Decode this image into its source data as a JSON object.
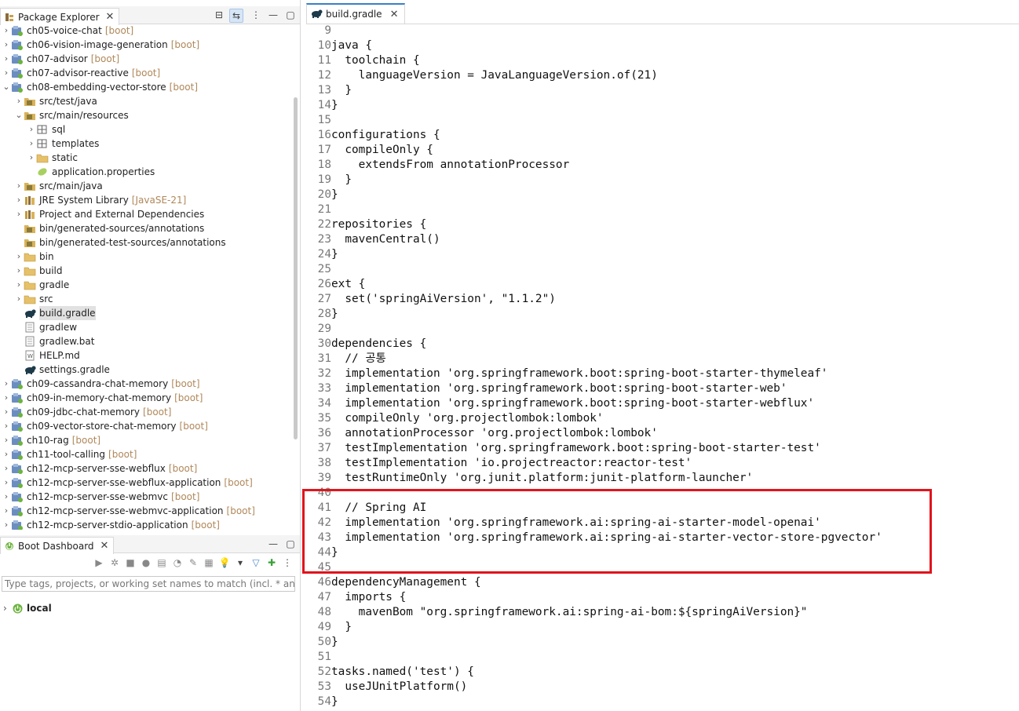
{
  "package_explorer": {
    "title": "Package Explorer",
    "tree": [
      {
        "label": "ch05-voice-chat",
        "decoration": "[boot]",
        "level": 0,
        "twisty": ">",
        "icon": "project-icon"
      },
      {
        "label": "ch06-vision-image-generation",
        "decoration": "[boot]",
        "level": 0,
        "twisty": ">",
        "icon": "project-icon"
      },
      {
        "label": "ch07-advisor",
        "decoration": "[boot]",
        "level": 0,
        "twisty": ">",
        "icon": "project-icon"
      },
      {
        "label": "ch07-advisor-reactive",
        "decoration": "[boot]",
        "level": 0,
        "twisty": ">",
        "icon": "project-icon"
      },
      {
        "label": "ch08-embedding-vector-store",
        "decoration": "[boot]",
        "level": 0,
        "twisty": "v",
        "icon": "project-icon"
      },
      {
        "label": "src/test/java",
        "decoration": "",
        "level": 1,
        "twisty": ">",
        "icon": "source-folder-icon"
      },
      {
        "label": "src/main/resources",
        "decoration": "",
        "level": 1,
        "twisty": "v",
        "icon": "source-folder-icon"
      },
      {
        "label": "sql",
        "decoration": "",
        "level": 2,
        "twisty": ">",
        "icon": "package-icon"
      },
      {
        "label": "templates",
        "decoration": "",
        "level": 2,
        "twisty": ">",
        "icon": "package-icon"
      },
      {
        "label": "static",
        "decoration": "",
        "level": 2,
        "twisty": ">",
        "icon": "folder-icon"
      },
      {
        "label": "application.properties",
        "decoration": "",
        "level": 2,
        "twisty": "",
        "icon": "properties-file-icon"
      },
      {
        "label": "src/main/java",
        "decoration": "",
        "level": 1,
        "twisty": ">",
        "icon": "source-folder-icon"
      },
      {
        "label": "JRE System Library",
        "decoration": "[JavaSE-21]",
        "level": 1,
        "twisty": ">",
        "icon": "library-icon"
      },
      {
        "label": "Project and External Dependencies",
        "decoration": "",
        "level": 1,
        "twisty": ">",
        "icon": "library-icon"
      },
      {
        "label": "bin/generated-sources/annotations",
        "decoration": "",
        "level": 1,
        "twisty": "",
        "icon": "source-folder-icon"
      },
      {
        "label": "bin/generated-test-sources/annotations",
        "decoration": "",
        "level": 1,
        "twisty": "",
        "icon": "source-folder-icon"
      },
      {
        "label": "bin",
        "decoration": "",
        "level": 1,
        "twisty": ">",
        "icon": "folder-icon"
      },
      {
        "label": "build",
        "decoration": "",
        "level": 1,
        "twisty": ">",
        "icon": "folder-icon"
      },
      {
        "label": "gradle",
        "decoration": "",
        "level": 1,
        "twisty": ">",
        "icon": "folder-icon"
      },
      {
        "label": "src",
        "decoration": "",
        "level": 1,
        "twisty": ">",
        "icon": "folder-icon"
      },
      {
        "label": "build.gradle",
        "decoration": "",
        "level": 1,
        "twisty": "",
        "icon": "gradle-elephant-icon",
        "selected": true
      },
      {
        "label": "gradlew",
        "decoration": "",
        "level": 1,
        "twisty": "",
        "icon": "text-file-icon"
      },
      {
        "label": "gradlew.bat",
        "decoration": "",
        "level": 1,
        "twisty": "",
        "icon": "text-file-icon"
      },
      {
        "label": "HELP.md",
        "decoration": "",
        "level": 1,
        "twisty": "",
        "icon": "markdown-file-icon"
      },
      {
        "label": "settings.gradle",
        "decoration": "",
        "level": 1,
        "twisty": "",
        "icon": "gradle-elephant-icon"
      },
      {
        "label": "ch09-cassandra-chat-memory",
        "decoration": "[boot]",
        "level": 0,
        "twisty": ">",
        "icon": "project-icon"
      },
      {
        "label": "ch09-in-memory-chat-memory",
        "decoration": "[boot]",
        "level": 0,
        "twisty": ">",
        "icon": "project-icon"
      },
      {
        "label": "ch09-jdbc-chat-memory",
        "decoration": "[boot]",
        "level": 0,
        "twisty": ">",
        "icon": "project-icon"
      },
      {
        "label": "ch09-vector-store-chat-memory",
        "decoration": "[boot]",
        "level": 0,
        "twisty": ">",
        "icon": "project-icon"
      },
      {
        "label": "ch10-rag",
        "decoration": "[boot]",
        "level": 0,
        "twisty": ">",
        "icon": "project-icon"
      },
      {
        "label": "ch11-tool-calling",
        "decoration": "[boot]",
        "level": 0,
        "twisty": ">",
        "icon": "project-icon"
      },
      {
        "label": "ch12-mcp-server-sse-webflux",
        "decoration": "[boot]",
        "level": 0,
        "twisty": ">",
        "icon": "project-icon"
      },
      {
        "label": "ch12-mcp-server-sse-webflux-application",
        "decoration": "[boot]",
        "level": 0,
        "twisty": ">",
        "icon": "project-icon"
      },
      {
        "label": "ch12-mcp-server-sse-webmvc",
        "decoration": "[boot]",
        "level": 0,
        "twisty": ">",
        "icon": "project-icon"
      },
      {
        "label": "ch12-mcp-server-sse-webmvc-application",
        "decoration": "[boot]",
        "level": 0,
        "twisty": ">",
        "icon": "project-icon"
      },
      {
        "label": "ch12-mcp-server-stdio-application",
        "decoration": "[boot]",
        "level": 0,
        "twisty": ">",
        "icon": "project-icon"
      }
    ]
  },
  "boot_dashboard": {
    "title": "Boot Dashboard",
    "filter_placeholder": "Type tags, projects, or working set names to match (incl. * and ? wilc",
    "local_label": "local"
  },
  "editor": {
    "tab_label": "build.gradle",
    "lines": [
      {
        "n": "9",
        "t": ""
      },
      {
        "n": "10",
        "t": "java {"
      },
      {
        "n": "11",
        "t": "  toolchain {"
      },
      {
        "n": "12",
        "t": "    languageVersion = JavaLanguageVersion.of(21)"
      },
      {
        "n": "13",
        "t": "  }"
      },
      {
        "n": "14",
        "t": "}"
      },
      {
        "n": "15",
        "t": ""
      },
      {
        "n": "16",
        "t": "configurations {"
      },
      {
        "n": "17",
        "t": "  compileOnly {"
      },
      {
        "n": "18",
        "t": "    extendsFrom annotationProcessor"
      },
      {
        "n": "19",
        "t": "  }"
      },
      {
        "n": "20",
        "t": "}"
      },
      {
        "n": "21",
        "t": ""
      },
      {
        "n": "22",
        "t": "repositories {"
      },
      {
        "n": "23",
        "t": "  mavenCentral()"
      },
      {
        "n": "24",
        "t": "}"
      },
      {
        "n": "25",
        "t": ""
      },
      {
        "n": "26",
        "t": "ext {"
      },
      {
        "n": "27",
        "t": "  set('springAiVersion', \"1.1.2\")"
      },
      {
        "n": "28",
        "t": "}"
      },
      {
        "n": "29",
        "t": ""
      },
      {
        "n": "30",
        "t": "dependencies {"
      },
      {
        "n": "31",
        "t": "  // 공통"
      },
      {
        "n": "32",
        "t": "  implementation 'org.springframework.boot:spring-boot-starter-thymeleaf'"
      },
      {
        "n": "33",
        "t": "  implementation 'org.springframework.boot:spring-boot-starter-web'"
      },
      {
        "n": "34",
        "t": "  implementation 'org.springframework.boot:spring-boot-starter-webflux'"
      },
      {
        "n": "35",
        "t": "  compileOnly 'org.projectlombok:lombok'"
      },
      {
        "n": "36",
        "t": "  annotationProcessor 'org.projectlombok:lombok'"
      },
      {
        "n": "37",
        "t": "  testImplementation 'org.springframework.boot:spring-boot-starter-test'"
      },
      {
        "n": "38",
        "t": "  testImplementation 'io.projectreactor:reactor-test'"
      },
      {
        "n": "39",
        "t": "  testRuntimeOnly 'org.junit.platform:junit-platform-launcher'"
      },
      {
        "n": "40",
        "t": ""
      },
      {
        "n": "41",
        "t": "  // Spring AI"
      },
      {
        "n": "42",
        "t": "  implementation 'org.springframework.ai:spring-ai-starter-model-openai'"
      },
      {
        "n": "43",
        "t": "  implementation 'org.springframework.ai:spring-ai-starter-vector-store-pgvector'"
      },
      {
        "n": "44",
        "t": "}"
      },
      {
        "n": "45",
        "t": ""
      },
      {
        "n": "46",
        "t": "dependencyManagement {"
      },
      {
        "n": "47",
        "t": "  imports {"
      },
      {
        "n": "48",
        "t": "    mavenBom \"org.springframework.ai:spring-ai-bom:${springAiVersion}\""
      },
      {
        "n": "49",
        "t": "  }"
      },
      {
        "n": "50",
        "t": "}"
      },
      {
        "n": "51",
        "t": ""
      },
      {
        "n": "52",
        "t": "tasks.named('test') {"
      },
      {
        "n": "53",
        "t": "  useJUnitPlatform()"
      },
      {
        "n": "54",
        "t": "}"
      }
    ]
  },
  "colors": {
    "highlight_border": "#e0141c",
    "decoration": "#b0885a",
    "tab_accent": "#3a7fc6"
  }
}
